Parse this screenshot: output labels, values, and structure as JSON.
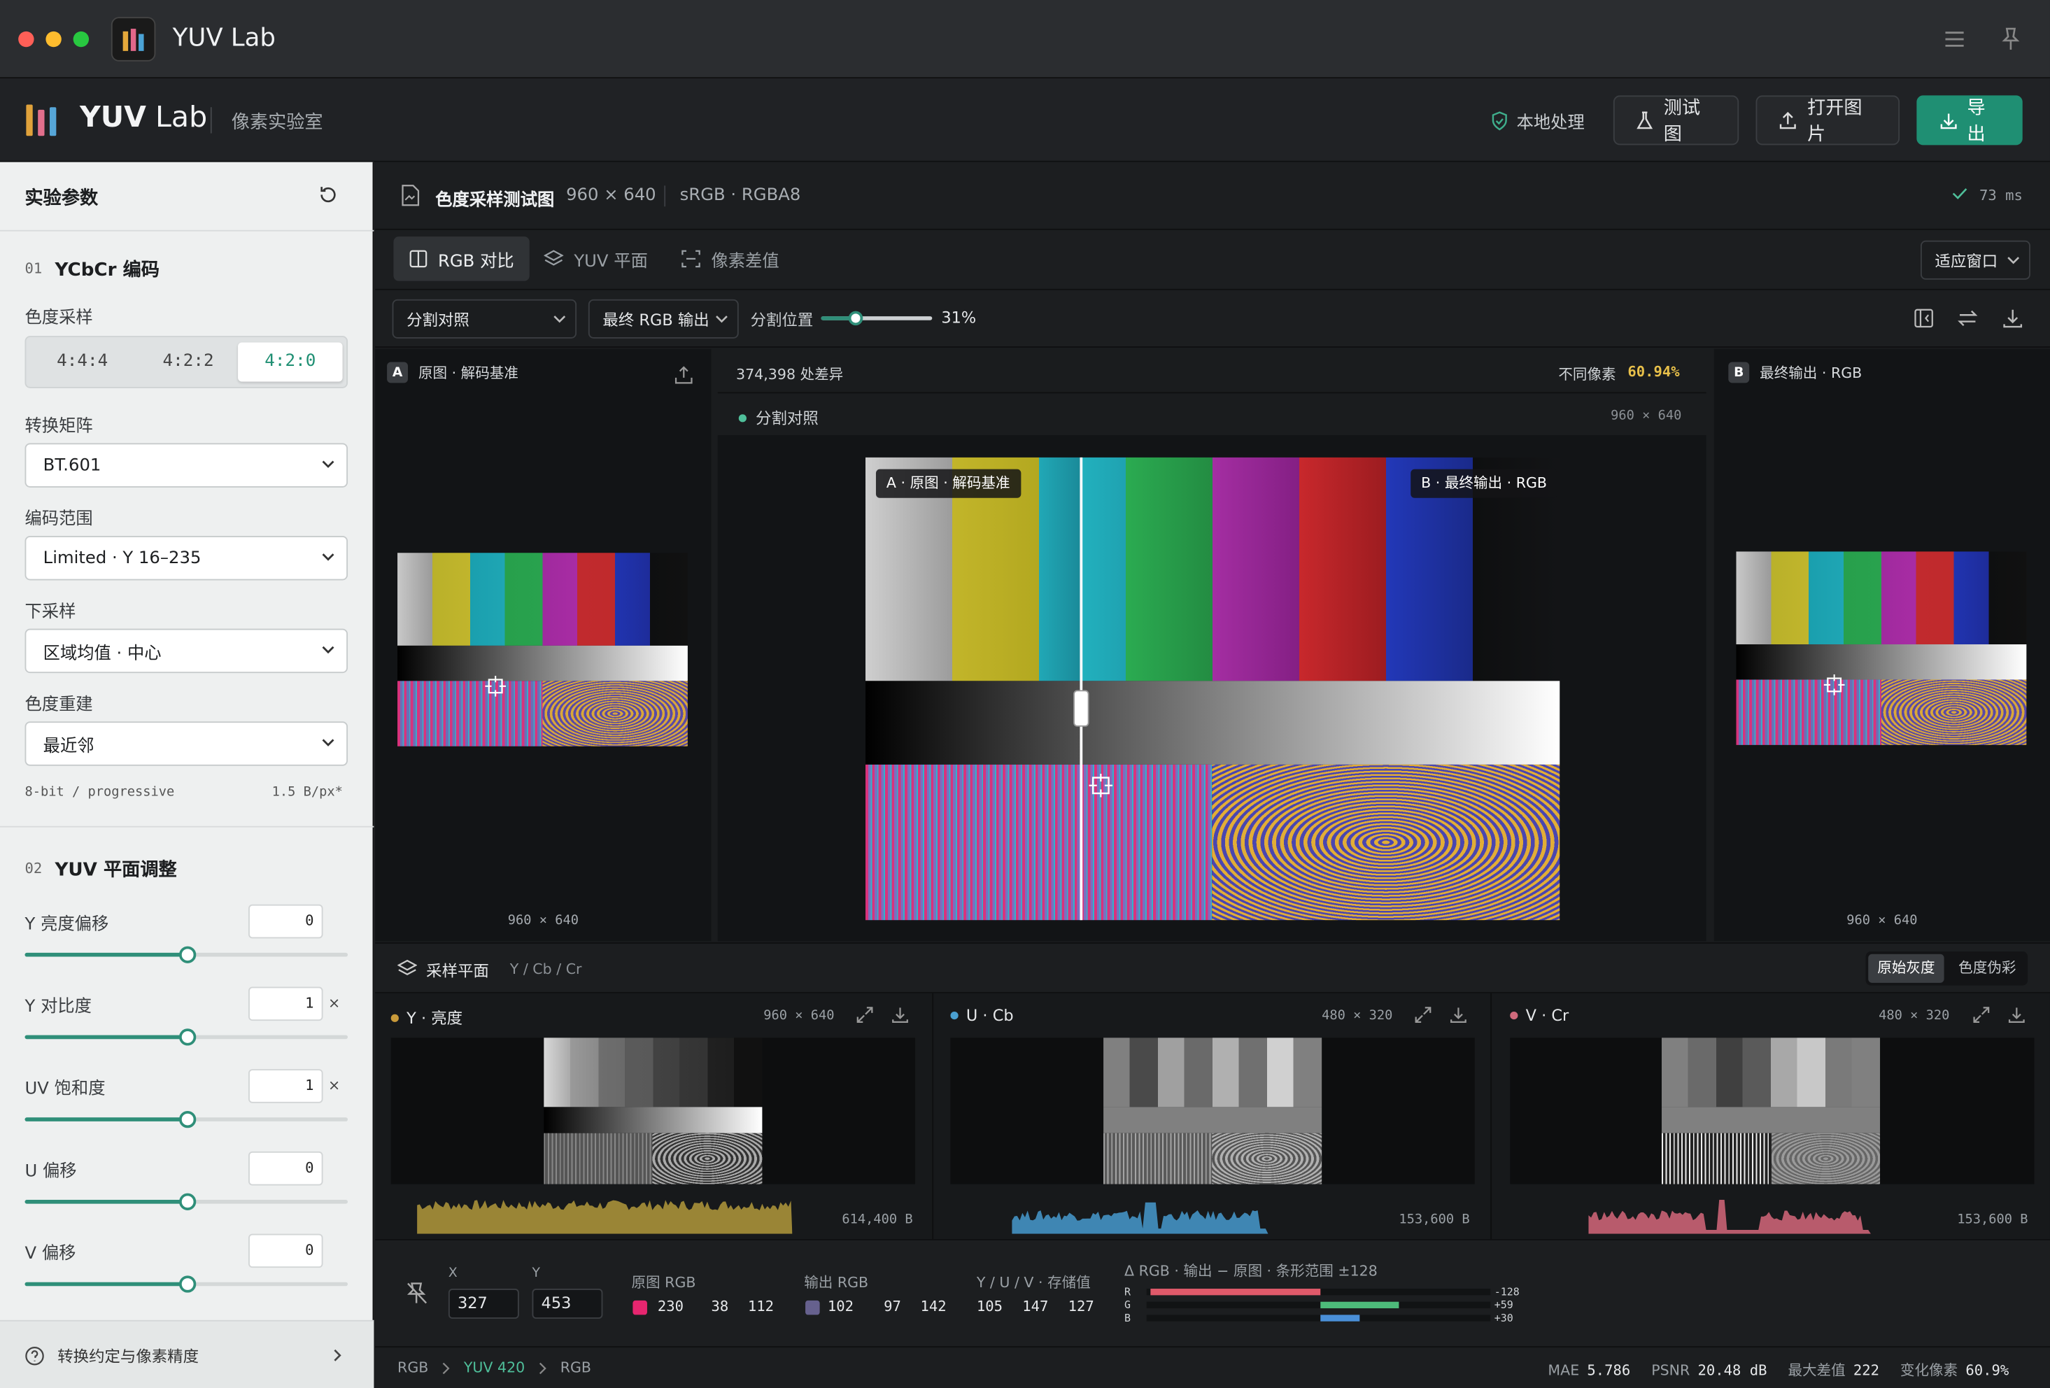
{
  "window": {
    "title": "YUV Lab"
  },
  "header": {
    "logo_name": "YUV",
    "logo_suffix": " Lab",
    "subtitle": "像素实验室",
    "local_label": "本地处理",
    "test_label": "测试图",
    "open_label": "打开图片",
    "export_label": "导出"
  },
  "sidebar": {
    "title": "实验参数",
    "section1": {
      "num": "01",
      "title": "YCbCr 编码"
    },
    "subsampling": {
      "label": "色度采样",
      "options": [
        "4:4:4",
        "4:2:2",
        "4:2:0"
      ],
      "selected": "4:2:0"
    },
    "matrix": {
      "label": "转换矩阵",
      "value": "BT.601"
    },
    "range": {
      "label": "编码范围",
      "value": "Limited · Y 16–235"
    },
    "downsample": {
      "label": "下采样",
      "value": "区域均值 · 中心"
    },
    "reconstruct": {
      "label": "色度重建",
      "value": "最近邻"
    },
    "info_left": "8-bit / progressive",
    "info_right": "1.5 B/px*",
    "section2": {
      "num": "02",
      "title": "YUV 平面调整"
    },
    "sliders": [
      {
        "label": "Y 亮度偏移",
        "value": "0",
        "unit": "",
        "fraction": 0.5
      },
      {
        "label": "Y 对比度",
        "value": "1",
        "unit": "×",
        "fraction": 0.5
      },
      {
        "label": "UV 饱和度",
        "value": "1",
        "unit": "×",
        "fraction": 0.5
      },
      {
        "label": "U 偏移",
        "value": "0",
        "unit": "",
        "fraction": 0.5
      },
      {
        "label": "V 偏移",
        "value": "0",
        "unit": "",
        "fraction": 0.5
      }
    ],
    "footer_link": "转换约定与像素精度"
  },
  "main": {
    "image_title": "色度采样测试图",
    "image_size": "960 × 640",
    "color_space": "sRGB · RGBA8",
    "timing": "73 ms",
    "tabs": [
      "RGB 对比",
      "YUV 平面",
      "像素差值"
    ],
    "fit_label": "适应窗口",
    "mode_select": "分割对照",
    "output_select": "最终 RGB 输出",
    "split_label": "分割位置",
    "split_value": "31%",
    "split_fraction": 0.31,
    "panel_a": {
      "badge": "A",
      "title": "原图 · 解码基准",
      "size": "960 × 640"
    },
    "diff_count": "374,398 处差异",
    "diff_label": "不同像素",
    "diff_pct": "60.94%",
    "split_mode": "分割对照",
    "center_size": "960 × 640",
    "overlay_a": "A · 原图 · 解码基准",
    "overlay_b": "B · 最终输出 · RGB",
    "panel_b": {
      "badge": "B",
      "title": "最终输出 · RGB",
      "size": "960 × 640"
    }
  },
  "planes": {
    "title": "采样平面",
    "subtitle": "Y / Cb / Cr",
    "toggle": [
      "原始灰度",
      "色度伪彩"
    ],
    "items": [
      {
        "name": "Y · 亮度",
        "size": "960 × 640",
        "bytes": "614,400 B",
        "color": "#c99a3a",
        "hist": "#9a8536"
      },
      {
        "name": "U · Cb",
        "size": "480 × 320",
        "bytes": "153,600 B",
        "color": "#4a9fd0",
        "hist": "#3f86b3"
      },
      {
        "name": "V · Cr",
        "size": "480 × 320",
        "bytes": "153,600 B",
        "color": "#d06a7c",
        "hist": "#b85b6c"
      }
    ]
  },
  "inspector": {
    "x_label": "X",
    "x": "327",
    "y_label": "Y",
    "y": "453",
    "orig_label": "原图 RGB",
    "orig": [
      "230",
      "38",
      "112"
    ],
    "orig_color": "#e6266f",
    "out_label": "输出 RGB",
    "out": [
      "102",
      "97",
      "142"
    ],
    "out_color": "#66618e",
    "yuv_label": "Y / U / V · 存储值",
    "yuv": [
      "105",
      "147",
      "127"
    ],
    "delta_title": "Δ RGB · 输出 − 原图 · 条形范围 ±128",
    "delta": [
      {
        "ch": "R",
        "val": "-128",
        "v": -128,
        "color": "#e05a6a"
      },
      {
        "ch": "G",
        "val": "+59",
        "v": 59,
        "color": "#4dbb7a"
      },
      {
        "ch": "B",
        "val": "+30",
        "v": 30,
        "color": "#4a8fd8"
      }
    ]
  },
  "status": {
    "crumbs": [
      "RGB",
      "YUV 420",
      "RGB"
    ],
    "mae_label": "MAE",
    "mae": "5.786",
    "psnr_label": "PSNR",
    "psnr": "20.48 dB",
    "max_label": "最大差值",
    "max": "222",
    "changed_label": "变化像素",
    "changed": "60.9%"
  },
  "colors": {
    "accent": "#1f8f73",
    "slider": "#2f8f79"
  }
}
